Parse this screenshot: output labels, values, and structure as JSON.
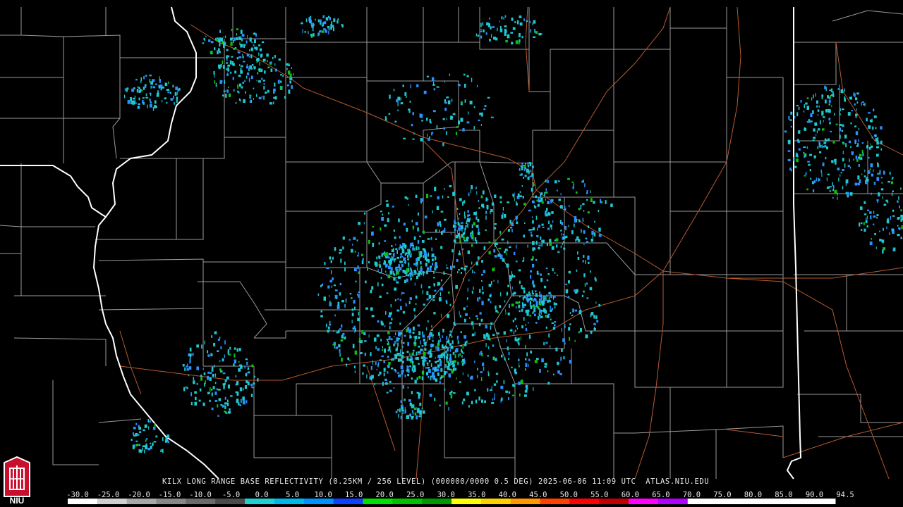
{
  "product": {
    "caption": "KILX LONG RANGE BASE REFLECTIVITY (0.25KM / 256 LEVEL) (000000/0000 0.5 DEG) 2025-06-06 11:09 UTC  ATLAS.NIU.EDU",
    "logo_text": "NIU"
  },
  "colorbar": {
    "labels": [
      "-30.0",
      "-25.0",
      "-20.0",
      "-15.0",
      "-10.0",
      "-5.0",
      "0.0",
      "5.0",
      "10.0",
      "15.0",
      "20.0",
      "25.0",
      "30.0",
      "35.0",
      "40.0",
      "45.0",
      "50.0",
      "55.0",
      "60.0",
      "65.0",
      "70.0",
      "75.0",
      "80.0",
      "85.0",
      "90.0",
      "94.5"
    ],
    "colors": [
      "#ffffff",
      "#cfcfcf",
      "#a8a8a8",
      "#888888",
      "#6a6a6a",
      "#4a4a4a",
      "#20d0d0",
      "#00b8e8",
      "#0090ff",
      "#1040ff",
      "#00e000",
      "#00c000",
      "#009800",
      "#ffff00",
      "#ffd000",
      "#ff9800",
      "#ff4000",
      "#ff0000",
      "#c00000",
      "#ff00ff",
      "#b000ff",
      "#ffffff",
      "#ffffff",
      "#ffffff",
      "#ffffff",
      "#ffffff"
    ]
  },
  "map_colors": {
    "background": "#000000",
    "county_lines": "#9a9a9a",
    "state_lines": "#ffffff",
    "roads": "#b85a30",
    "echo_light": "#20c8d0",
    "echo_mid": "#2a90ff",
    "echo_strong": "#10c010"
  }
}
